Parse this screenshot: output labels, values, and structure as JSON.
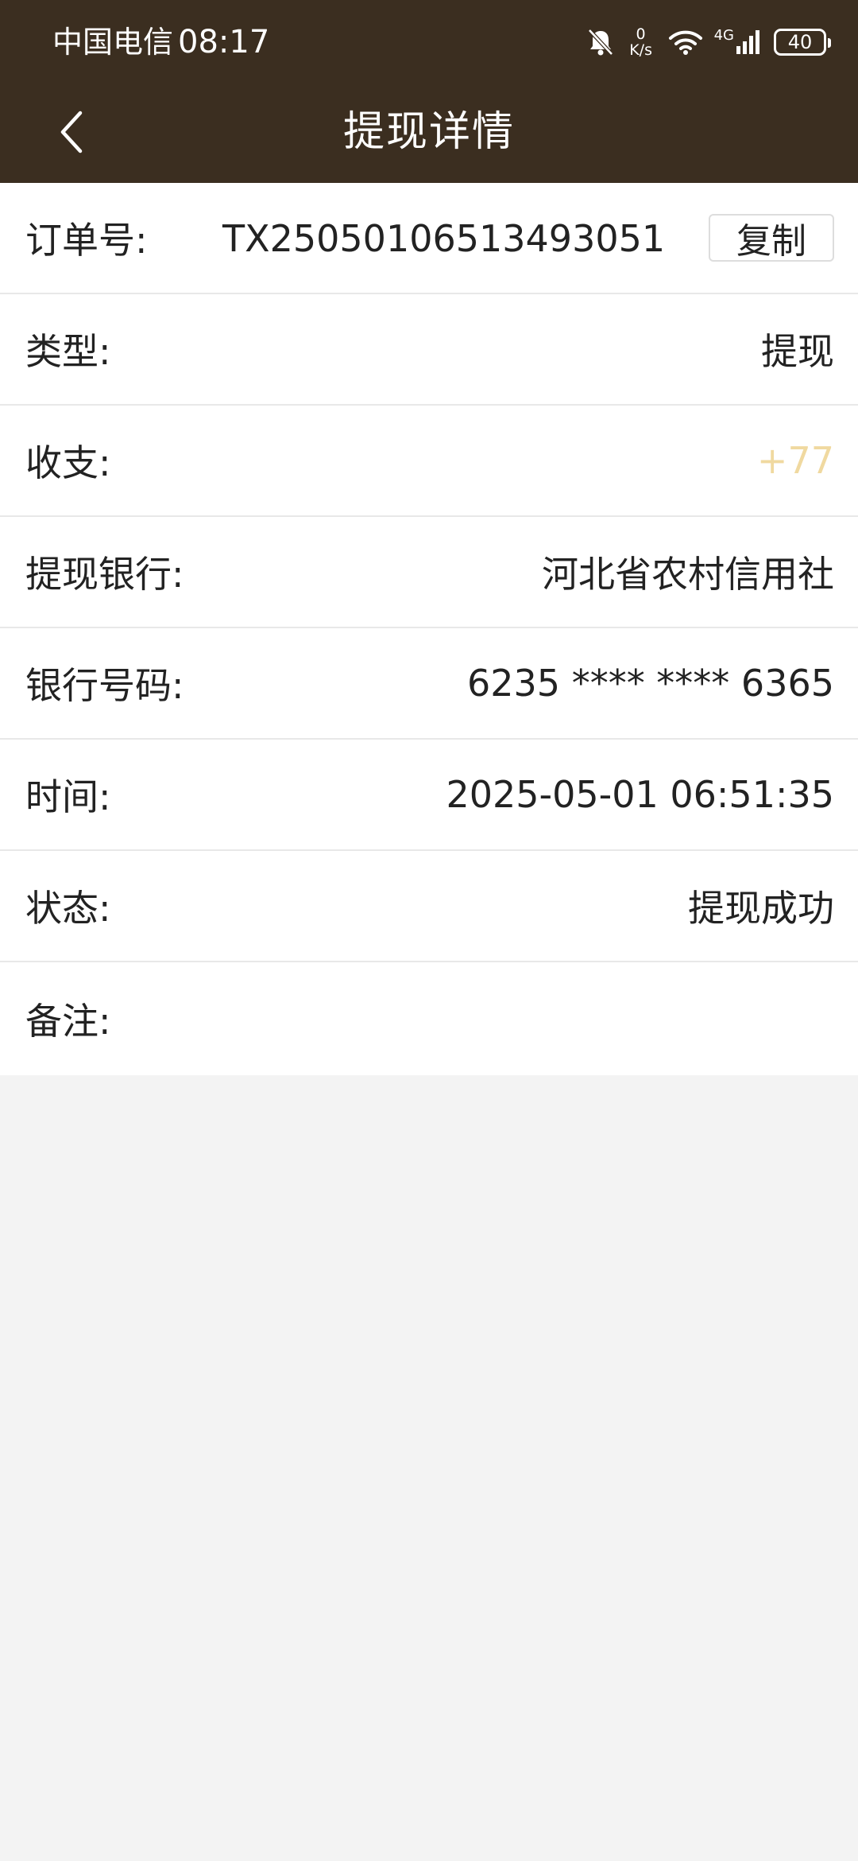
{
  "status_bar": {
    "carrier": "中国电信",
    "time": "08:17",
    "net_speed_value": "0",
    "net_speed_unit": "K/s",
    "network_type": "4G",
    "battery": "40"
  },
  "nav": {
    "title": "提现详情",
    "back_icon": "chevron-left-icon"
  },
  "details": {
    "order": {
      "label": "订单号:",
      "value": "TX25050106513493051",
      "copy_label": "复制"
    },
    "type": {
      "label": "类型:",
      "value": "提现"
    },
    "amount": {
      "label": "收支:",
      "value": "+77"
    },
    "bank": {
      "label": "提现银行:",
      "value": "河北省农村信用社"
    },
    "card": {
      "label": "银行号码:",
      "value": "6235 **** **** 6365"
    },
    "time": {
      "label": "时间:",
      "value": "2025-05-01 06:51:35"
    },
    "status": {
      "label": "状态:",
      "value": "提现成功"
    },
    "remark": {
      "label": "备注:",
      "value": ""
    }
  },
  "colors": {
    "header_bg": "#3b2e20",
    "page_bg": "#f3f3f3",
    "income": "#f0d9a0"
  }
}
